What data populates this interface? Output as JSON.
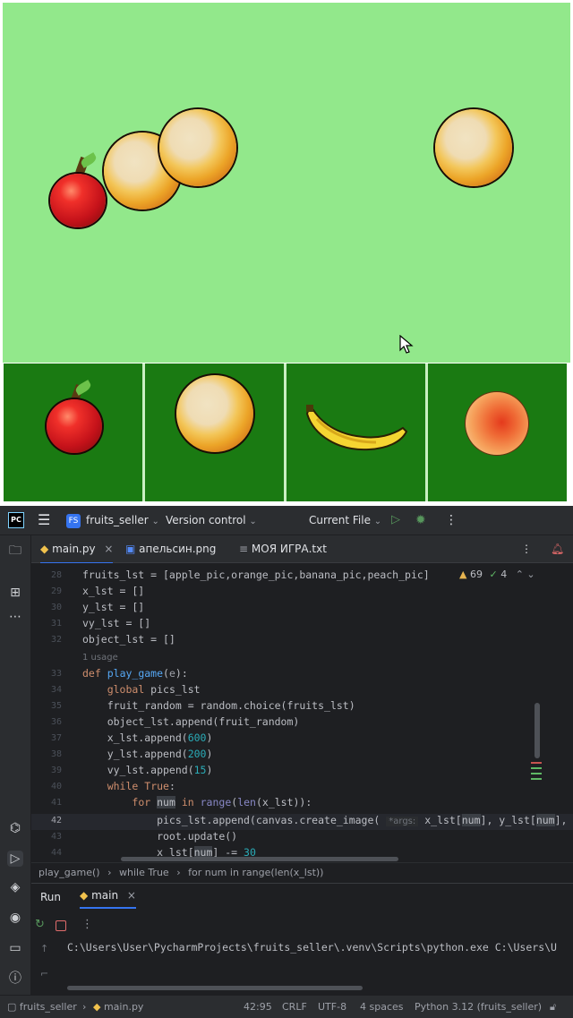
{
  "toolbar": {
    "logo_text": "PC",
    "project_badge": "FS",
    "project_name": "fruits_seller",
    "version_control": "Version control",
    "run_config": "Current File"
  },
  "tabs": [
    {
      "label": "main.py"
    },
    {
      "label": "апельсин.png"
    },
    {
      "label": "МОЯ ИГРА.txt"
    }
  ],
  "inspections": {
    "warnings": "69",
    "checks": "4"
  },
  "editor": {
    "usage_hint": "1 usage",
    "arg_hint": "*args:"
  },
  "breadcrumbs": [
    "play_game()",
    "while True",
    "for num in range(len(x_lst))"
  ],
  "run": {
    "tab_run": "Run",
    "tab_main": "main",
    "console_line": "C:\\Users\\User\\PycharmProjects\\fruits_seller\\.venv\\Scripts\\python.exe C:\\Users\\U"
  },
  "status": {
    "project": "fruits_seller",
    "file": "main.py",
    "position": "42:95",
    "line_sep": "CRLF",
    "encoding": "UTF-8",
    "indent": "4 spaces",
    "interpreter": "Python 3.12 (fruits_seller)"
  },
  "colors": {
    "field": "#92e88b",
    "tile": "#1a7a12",
    "ide_bg": "#1e1f22",
    "accent": "#3574f0"
  }
}
